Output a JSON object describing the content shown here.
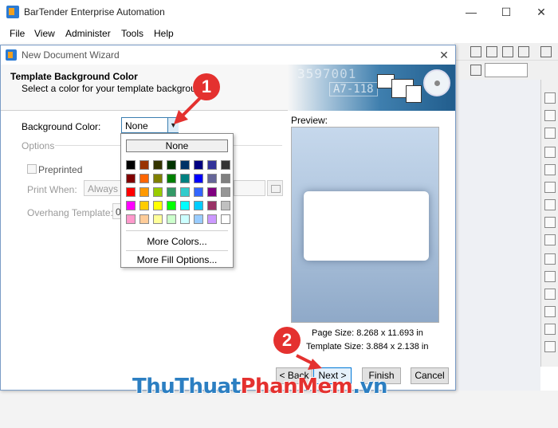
{
  "app": {
    "title": "BarTender Enterprise Automation",
    "minimize": "—",
    "maximize": "☐",
    "close": "✕"
  },
  "menu": [
    "File",
    "View",
    "Administer",
    "Tools",
    "Help"
  ],
  "dialog": {
    "title": "New Document Wizard",
    "close": "✕",
    "header_title": "Template Background Color",
    "header_subtitle": "Select a color for your template background.",
    "banner_number": "3597001",
    "banner_code": "A7-118",
    "bg_color_label": "Background Color:",
    "bg_color_value": "None",
    "options_label": "Options",
    "preprinted_label": "Preprinted",
    "print_when_label": "Print When:",
    "print_when_value": "Always",
    "overhang_label": "Overhang Template:",
    "overhang_value": "0",
    "preview_label": "Preview:",
    "page_size": "Page Size:  8.268 x 11.693 in",
    "template_size": "Template Size:  3.884 x 2.138 in",
    "buttons": {
      "back": "< Back",
      "next": "Next  >",
      "finish": "Finish",
      "cancel": "Cancel"
    }
  },
  "color_dropdown": {
    "none_label": "None",
    "more_colors": "More Colors...",
    "more_fill": "More Fill Options...",
    "swatches": [
      [
        "#000000",
        "#993300",
        "#333300",
        "#003300",
        "#003366",
        "#000080",
        "#333399",
        "#333333"
      ],
      [
        "#800000",
        "#ff6600",
        "#808000",
        "#008000",
        "#008080",
        "#0000ff",
        "#666699",
        "#808080"
      ],
      [
        "#ff0000",
        "#ff9900",
        "#99cc00",
        "#339966",
        "#33cccc",
        "#3366ff",
        "#800080",
        "#969696"
      ],
      [
        "#ff00ff",
        "#ffcc00",
        "#ffff00",
        "#00ff00",
        "#00ffff",
        "#00ccff",
        "#993366",
        "#c0c0c0"
      ],
      [
        "#ff99cc",
        "#ffcc99",
        "#ffff99",
        "#ccffcc",
        "#ccffff",
        "#99ccff",
        "#cc99ff",
        "#ffffff"
      ]
    ]
  },
  "annotations": {
    "step1": "1",
    "step2": "2",
    "color": "#e4312f"
  },
  "watermark": {
    "part_a": "Thu",
    "part_b": "Thuat",
    "part_c": "PhanMem",
    "part_d": ".vn"
  }
}
